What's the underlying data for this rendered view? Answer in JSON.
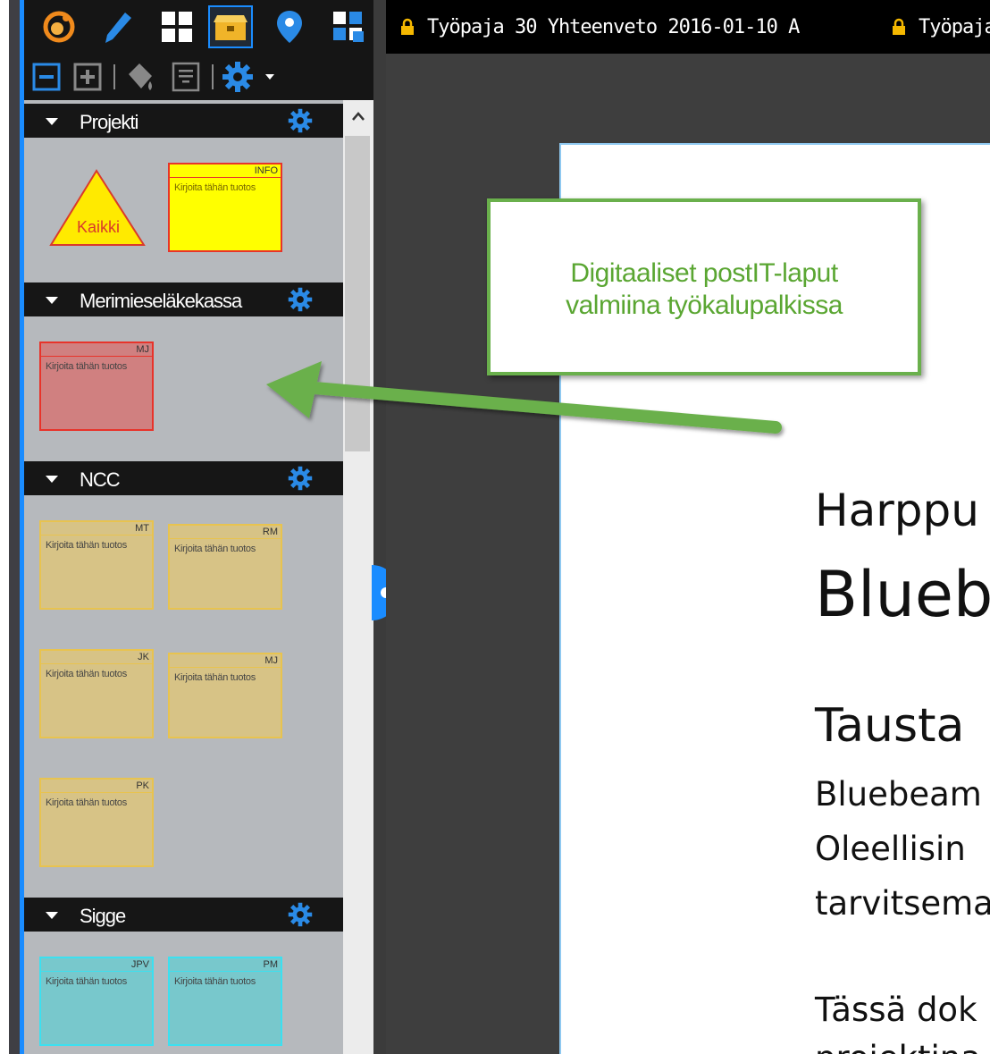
{
  "tabs": [
    {
      "label": "Työpaja 30 Yhteenveto 2016-01-10 A"
    },
    {
      "label": "Työpaja"
    }
  ],
  "sections": [
    {
      "label": "Projekti"
    },
    {
      "label": "Merimieseläkekassa"
    },
    {
      "label": "NCC"
    },
    {
      "label": "Sigge"
    }
  ],
  "notes": {
    "placeholder": "Kirjoita tähän tuotos",
    "kaikki": "Kaikki",
    "info": "INFO",
    "mj_red": "MJ",
    "mt": "MT",
    "rm": "RM",
    "jk": "JK",
    "mj": "MJ",
    "pk": "PK",
    "jpv": "JPV",
    "pm": "PM"
  },
  "callout": {
    "line1": "Digitaaliset postIT-laput",
    "line2": "valmiina työkalupalkissa"
  },
  "document": {
    "heading1": "Harppu",
    "heading2": "Blueb",
    "heading3": "Tausta",
    "line1": "Bluebeam",
    "line2": "Oleellisin",
    "line3": "tarvitsema",
    "line4": "Tässä dok",
    "line5": "projektina"
  },
  "colors": {
    "accent": "#1a8cff",
    "callout_green": "#6ab04c",
    "note_yellow": "#ffff00",
    "note_red": "#d08080",
    "note_tan": "#d7c386",
    "note_cyan": "#78c8cc"
  }
}
